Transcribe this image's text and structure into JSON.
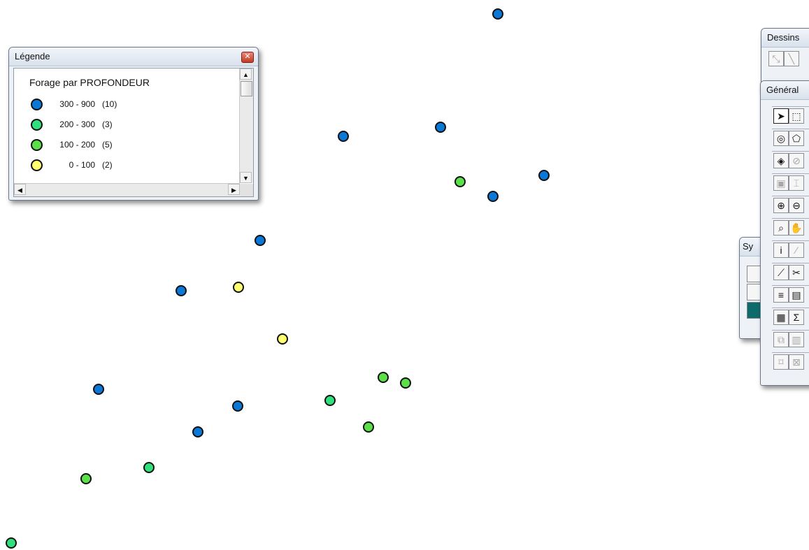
{
  "legend": {
    "window_title": "Légende",
    "close_icon": "close-icon",
    "title": "Forage par PROFONDEUR",
    "items": [
      {
        "range": "300 - 900",
        "count": "(10)",
        "color": "#0a78d7"
      },
      {
        "range": "200 - 300",
        "count": "(3)",
        "color": "#2fe07c"
      },
      {
        "range": "100 - 200",
        "count": "(5)",
        "color": "#5ce04a"
      },
      {
        "range": "0 - 100",
        "count": "(2)",
        "color": "#ffff70"
      }
    ]
  },
  "palettes": {
    "dessins_title": "Dessins",
    "general_title": "Général",
    "symbol_title": "Sy",
    "general_tools": [
      [
        "arrow-select-icon",
        "marquee-select-icon"
      ],
      [
        "radius-select-icon",
        "polygon-select-icon"
      ],
      [
        "boundary-select-icon",
        "invert-select-icon"
      ],
      [
        "graph-select-icon",
        "label-tool-icon"
      ],
      [
        "zoom-in-icon",
        "zoom-out-icon"
      ],
      [
        "change-view-icon",
        "grabber-hand-icon"
      ],
      [
        "info-tool-icon",
        "hotlink-icon"
      ],
      [
        "ruler-icon",
        "drag-window-icon"
      ],
      [
        "layer-control-icon",
        "show-statistics-icon"
      ],
      [
        "legend-manager-icon",
        "statistics-sum-icon"
      ],
      [
        "legend-designer-icon",
        "layout-designer-icon"
      ],
      [
        "clip-region-icon",
        "set-target-icon"
      ]
    ]
  },
  "map": {
    "point_colors": {
      "deep": "#0a78d7",
      "mid": "#2fe07c",
      "shallow": "#5ce04a",
      "surface": "#ffff70"
    },
    "points": [
      {
        "class": "deep"
      },
      {
        "class": "deep"
      },
      {
        "class": "deep"
      },
      {
        "class": "deep"
      },
      {
        "class": "deep"
      },
      {
        "class": "deep"
      },
      {
        "class": "deep"
      },
      {
        "class": "deep"
      },
      {
        "class": "deep"
      },
      {
        "class": "deep"
      },
      {
        "class": "mid"
      },
      {
        "class": "mid"
      },
      {
        "class": "mid"
      },
      {
        "class": "shallow"
      },
      {
        "class": "shallow"
      },
      {
        "class": "shallow"
      },
      {
        "class": "shallow"
      },
      {
        "class": "shallow"
      },
      {
        "class": "surface"
      },
      {
        "class": "surface"
      }
    ]
  }
}
